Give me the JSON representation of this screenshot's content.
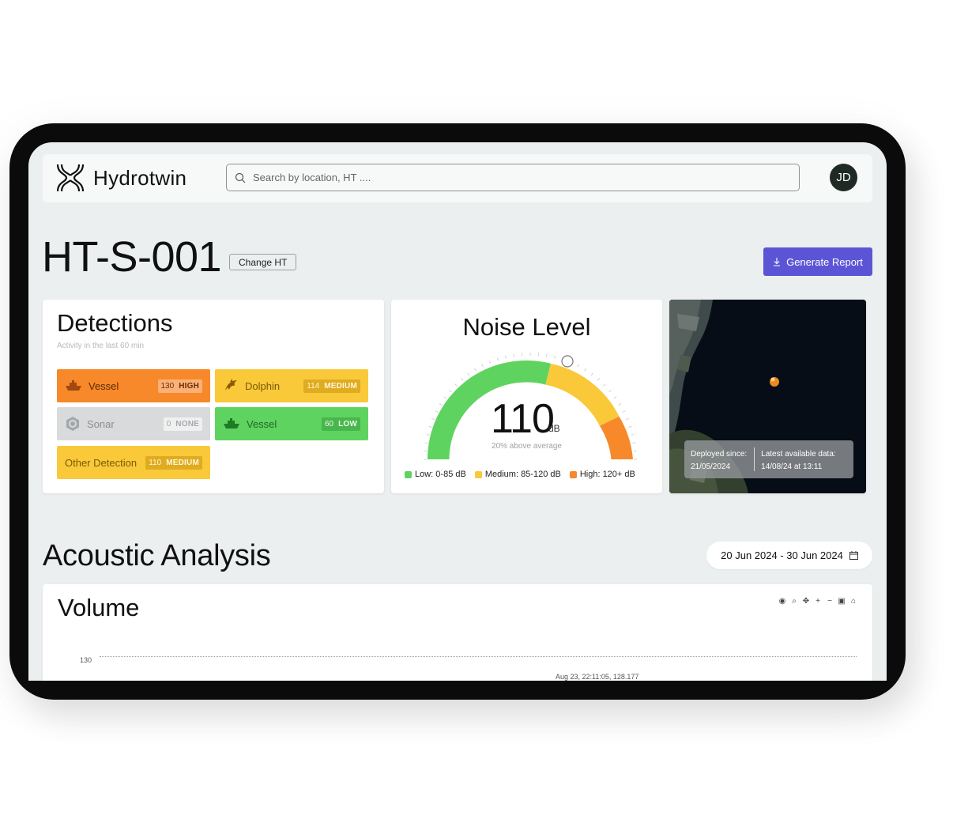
{
  "app": {
    "name": "Hydrotwin",
    "search_placeholder": "Search by location, HT ....",
    "user_initials": "JD"
  },
  "header": {
    "title": "HT-S-001",
    "change_label": "Change HT",
    "report_label": "Generate Report"
  },
  "detections": {
    "title": "Detections",
    "subtitle": "Activity in the last 60 min",
    "items": [
      {
        "label": "Vessel",
        "value": "130",
        "level": "HIGH",
        "icon": "vessel-icon",
        "color": "#f7892a"
      },
      {
        "label": "Dolphin",
        "value": "114",
        "level": "MEDIUM",
        "icon": "dolphin-icon",
        "color": "#f9c93a"
      },
      {
        "label": "Sonar",
        "value": "0",
        "level": "NONE",
        "icon": "sonar-icon",
        "color": "#d8dadb"
      },
      {
        "label": "Vessel",
        "value": "60",
        "level": "LOW",
        "icon": "vessel-icon",
        "color": "#5fd360"
      },
      {
        "label": "Other Detection",
        "value": "110",
        "level": "MEDIUM",
        "icon": "",
        "color": "#f9c93a"
      }
    ]
  },
  "noise": {
    "title": "Noise Level",
    "value": "110",
    "unit": "dB",
    "subtitle": "20% above average",
    "gauge_min": 0,
    "gauge_max": 150,
    "legend": [
      {
        "label": "Low: 0-85 dB",
        "color": "#5fd360"
      },
      {
        "label": "Medium: 85-120 dB",
        "color": "#f9c93a"
      },
      {
        "label": "High: 120+ dB",
        "color": "#f7892a"
      }
    ]
  },
  "map": {
    "deployed_label": "Deployed since:",
    "deployed_value": "21/05/2024",
    "latest_label": "Latest available data:",
    "latest_value": "14/08/24 at 13:11"
  },
  "acoustic": {
    "title": "Acoustic Analysis",
    "date_range": "20 Jun 2024 - 30 Jun 2024",
    "volume_title": "Volume",
    "toolbar_icons": [
      "camera-icon",
      "zoom-icon",
      "pan-icon",
      "zoom-in-icon",
      "zoom-out-icon",
      "autoscale-icon",
      "home-icon"
    ],
    "y_tick": "130",
    "hover_label": "Aug 23, 22:11:05, 128.177"
  }
}
